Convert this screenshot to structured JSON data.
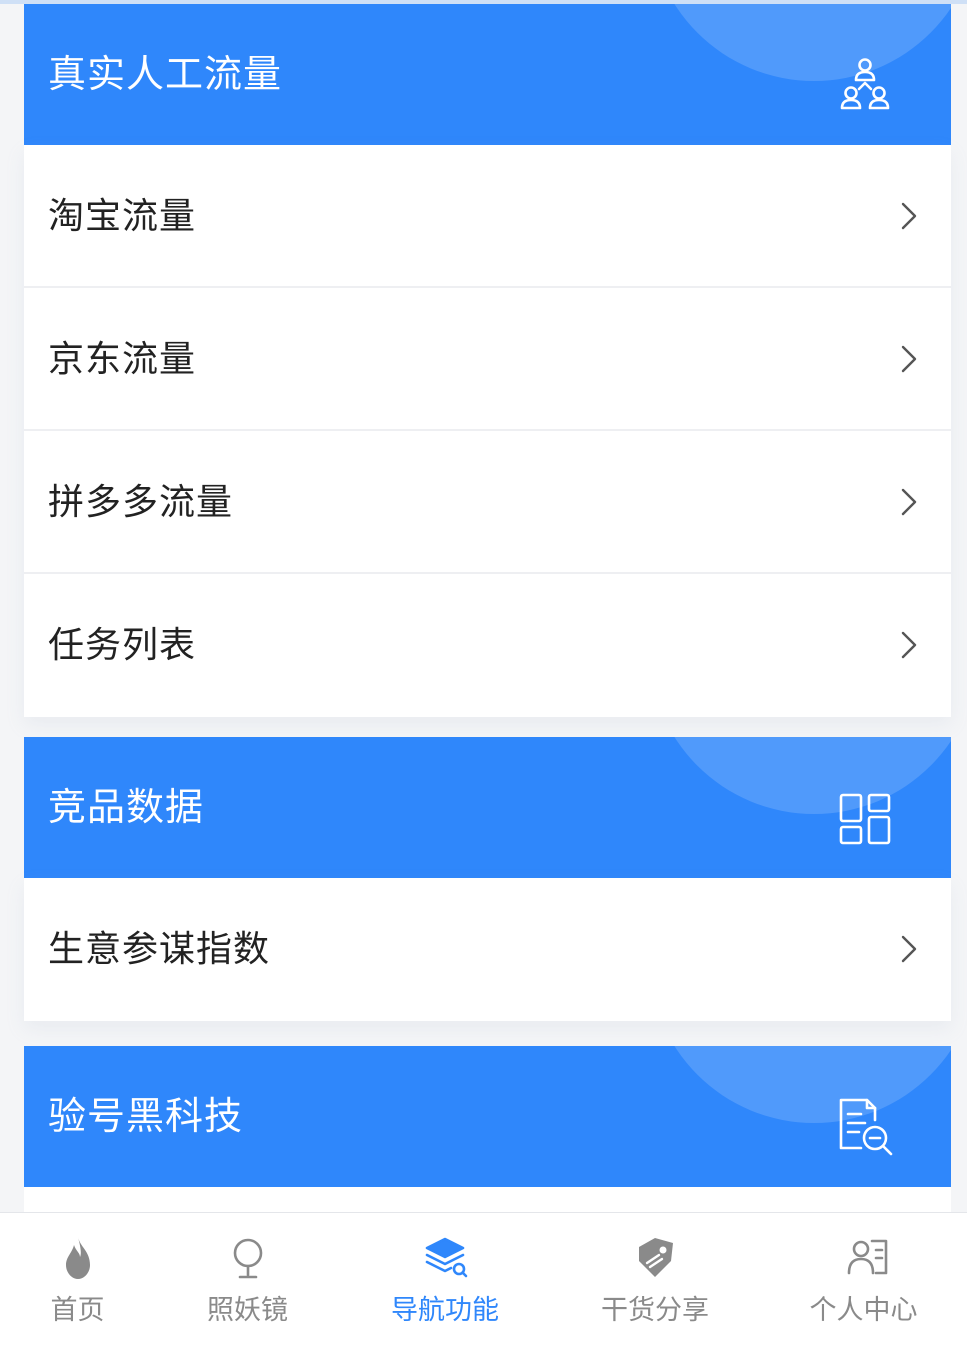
{
  "colors": {
    "accent": "#2f87fb",
    "inactive": "#8a8a8a"
  },
  "sections": [
    {
      "title": "真实人工流量",
      "icon": "users-group-icon",
      "items": [
        {
          "label": "淘宝流量"
        },
        {
          "label": "京东流量"
        },
        {
          "label": "拼多多流量"
        },
        {
          "label": "任务列表"
        }
      ]
    },
    {
      "title": "竞品数据",
      "icon": "grid-icon",
      "items": [
        {
          "label": "生意参谋指数"
        }
      ]
    },
    {
      "title": "验号黑科技",
      "icon": "document-search-icon",
      "items": []
    }
  ],
  "tabbar": {
    "active_index": 2,
    "tabs": [
      {
        "label": "首页",
        "icon": "flame-icon"
      },
      {
        "label": "照妖镜",
        "icon": "mirror-icon"
      },
      {
        "label": "导航功能",
        "icon": "layers-icon"
      },
      {
        "label": "干货分享",
        "icon": "tag-icon"
      },
      {
        "label": "个人中心",
        "icon": "user-card-icon"
      }
    ]
  }
}
